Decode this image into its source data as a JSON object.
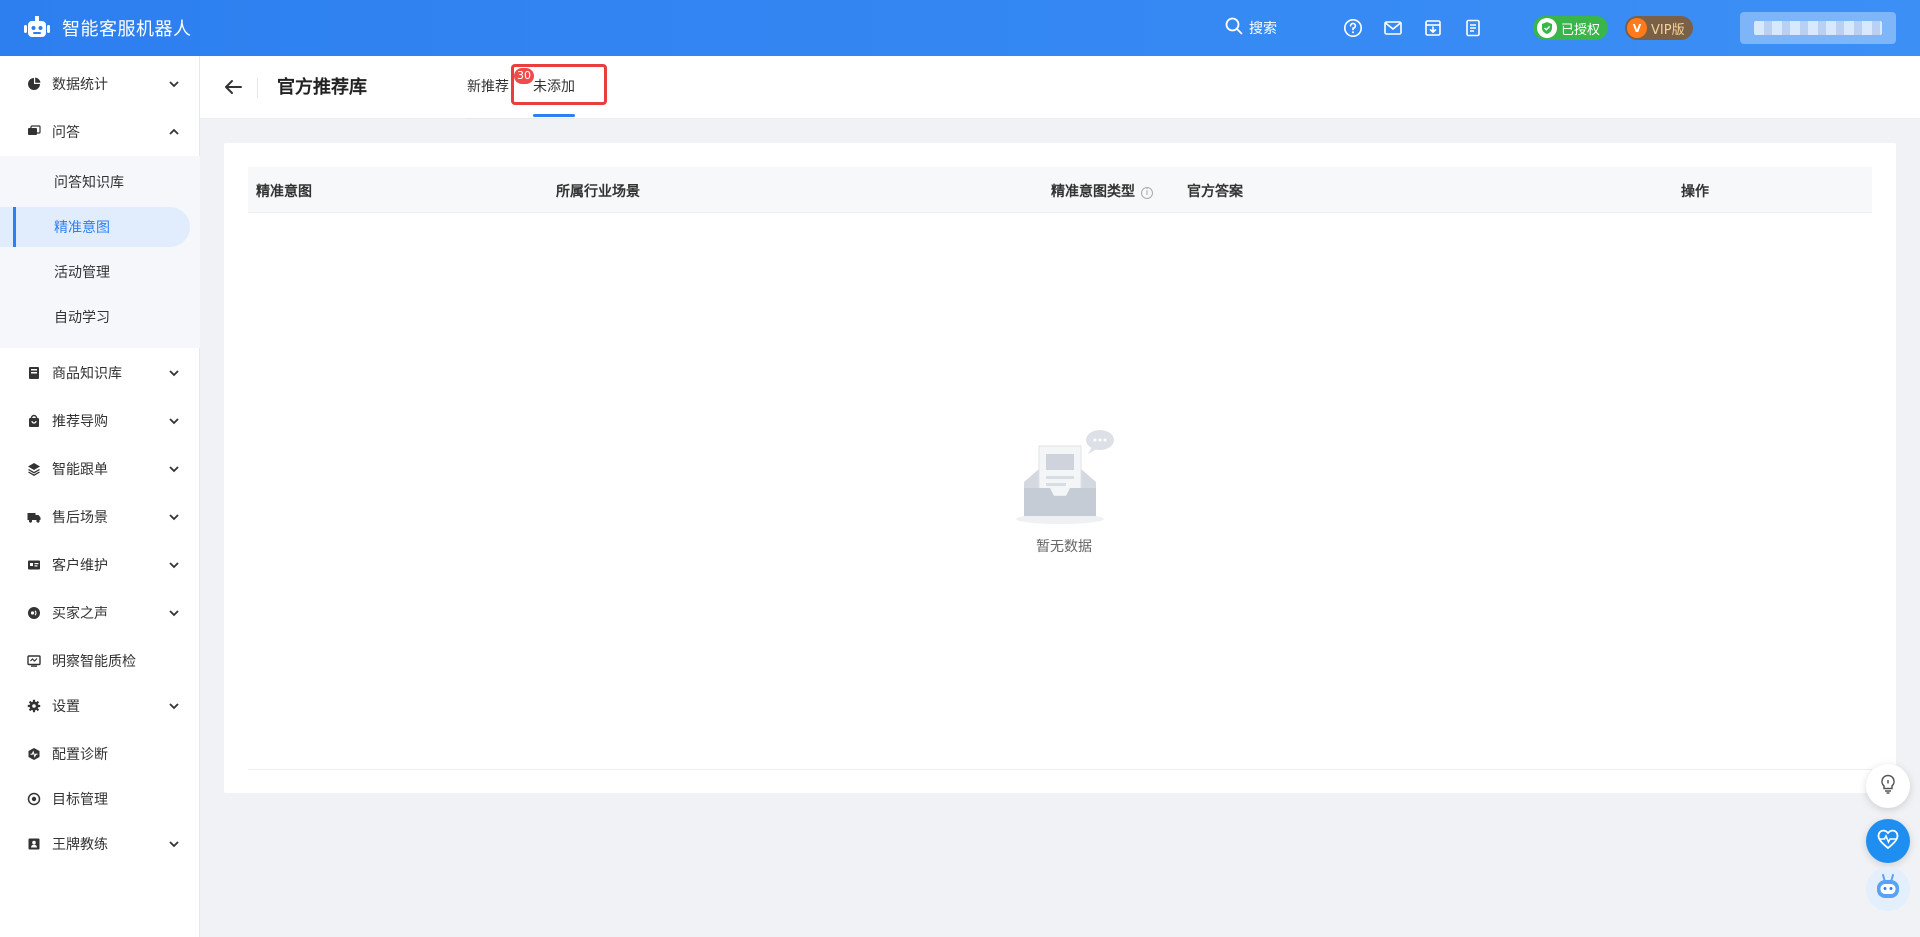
{
  "header": {
    "app_title": "智能客服机器人",
    "search_label": "搜索",
    "auth_badge": "已授权",
    "vip_badge": "VIP版",
    "vip_letter": "V",
    "icons": [
      "help-circle-icon",
      "mail-icon",
      "download-box-icon",
      "document-icon"
    ]
  },
  "sidebar": {
    "items": [
      {
        "label": "数据统计",
        "icon": "pie-chart-icon",
        "expandable": true
      },
      {
        "label": "问答",
        "icon": "chat-icon",
        "expandable": true,
        "expanded": true
      },
      {
        "label": "商品知识库",
        "icon": "book-icon",
        "expandable": true
      },
      {
        "label": "推荐导购",
        "icon": "shopping-bag-icon",
        "expandable": true
      },
      {
        "label": "智能跟单",
        "icon": "layers-icon",
        "expandable": true
      },
      {
        "label": "售后场景",
        "icon": "truck-icon",
        "expandable": true
      },
      {
        "label": "客户维护",
        "icon": "id-card-icon",
        "expandable": true
      },
      {
        "label": "买家之声",
        "icon": "voice-icon",
        "expandable": true
      },
      {
        "label": "明察智能质检",
        "icon": "monitor-icon",
        "expandable": false
      },
      {
        "label": "设置",
        "icon": "gear-icon",
        "expandable": true
      },
      {
        "label": "配置诊断",
        "icon": "diagnose-icon",
        "expandable": false
      },
      {
        "label": "目标管理",
        "icon": "target-icon",
        "expandable": false
      },
      {
        "label": "王牌教练",
        "icon": "coach-icon",
        "expandable": true
      }
    ],
    "sub_items": [
      {
        "label": "问答知识库",
        "active": false
      },
      {
        "label": "精准意图",
        "active": true
      },
      {
        "label": "活动管理",
        "active": false
      },
      {
        "label": "自动学习",
        "active": false
      }
    ]
  },
  "page": {
    "title": "官方推荐库",
    "tabs": [
      {
        "label": "新推荐",
        "active": false
      },
      {
        "label": "未添加",
        "active": true
      }
    ],
    "badge_count": "30"
  },
  "table": {
    "columns": [
      "精准意图",
      "所属行业场景",
      "精准意图类型",
      "官方答案",
      "操作"
    ],
    "info_glyph": "i",
    "rows": [],
    "empty_text": "暂无数据"
  },
  "colors": {
    "header_bg": "#2d7ff0",
    "accent": "#2e7ff0",
    "badge_red": "#f04a4a",
    "highlight_red": "#ea3d3d",
    "auth_green": "#39b54a",
    "vip_brown": "#7a6047"
  }
}
